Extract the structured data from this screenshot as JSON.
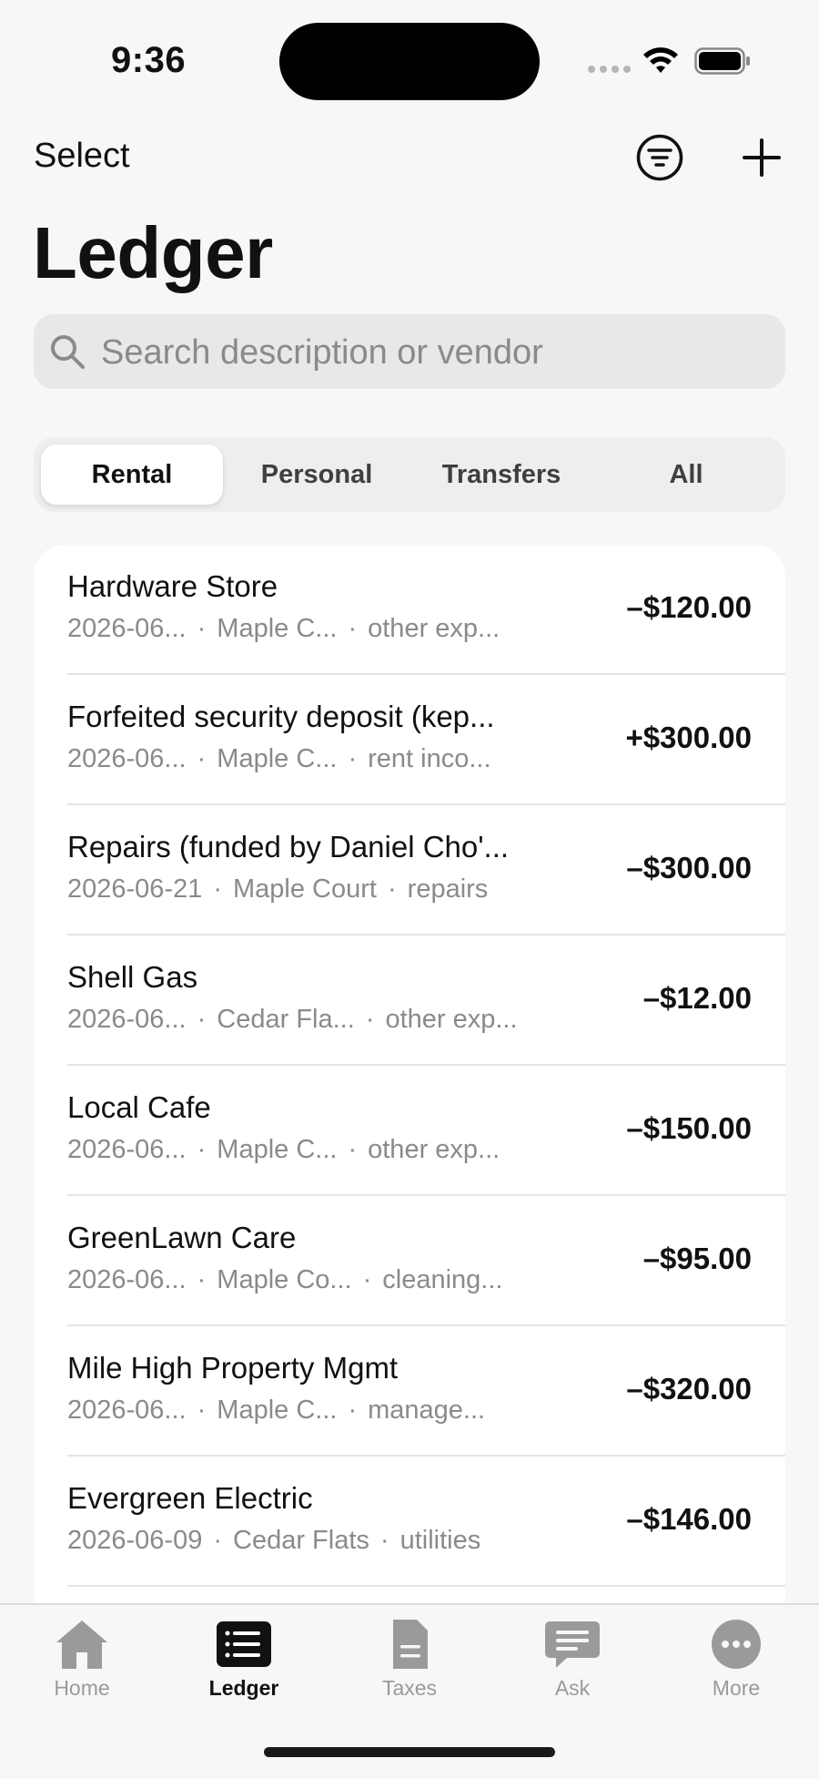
{
  "status_bar": {
    "time": "9:36"
  },
  "nav": {
    "select_label": "Select",
    "title": "Ledger"
  },
  "search": {
    "placeholder": "Search description or vendor",
    "value": ""
  },
  "segments": [
    {
      "label": "Rental",
      "active": true
    },
    {
      "label": "Personal",
      "active": false
    },
    {
      "label": "Transfers",
      "active": false
    },
    {
      "label": "All",
      "active": false
    }
  ],
  "transactions": [
    {
      "name": "Hardware Store",
      "date": "2026-06...",
      "property": "Maple C...",
      "category": "other exp...",
      "amount": "–$120.00"
    },
    {
      "name": "Forfeited security deposit (kep...",
      "date": "2026-06...",
      "property": "Maple C...",
      "category": "rent inco...",
      "amount": "+$300.00"
    },
    {
      "name": "Repairs (funded by Daniel Cho'...",
      "date": "2026-06-21",
      "property": "Maple Court",
      "category": "repairs",
      "amount": "–$300.00"
    },
    {
      "name": "Shell Gas",
      "date": "2026-06...",
      "property": "Cedar Fla...",
      "category": "other exp...",
      "amount": "–$12.00"
    },
    {
      "name": "Local Cafe",
      "date": "2026-06...",
      "property": "Maple C...",
      "category": "other exp...",
      "amount": "–$150.00"
    },
    {
      "name": "GreenLawn Care",
      "date": "2026-06...",
      "property": "Maple Co...",
      "category": "cleaning...",
      "amount": "–$95.00"
    },
    {
      "name": "Mile High Property Mgmt",
      "date": "2026-06...",
      "property": "Maple C...",
      "category": "manage...",
      "amount": "–$320.00"
    },
    {
      "name": "Evergreen Electric",
      "date": "2026-06-09",
      "property": "Cedar Flats",
      "category": "utilities",
      "amount": "–$146.00"
    }
  ],
  "tabs": [
    {
      "label": "Home",
      "icon": "home-icon",
      "active": false
    },
    {
      "label": "Ledger",
      "icon": "ledger-icon",
      "active": true
    },
    {
      "label": "Taxes",
      "icon": "document-icon",
      "active": false
    },
    {
      "label": "Ask",
      "icon": "chat-icon",
      "active": false
    },
    {
      "label": "More",
      "icon": "more-icon",
      "active": false
    }
  ],
  "meta_separator": "·",
  "colors": {
    "accent": "#111111",
    "secondary_text": "#8a8a8e",
    "inactive_tab": "#9a9a9a"
  }
}
